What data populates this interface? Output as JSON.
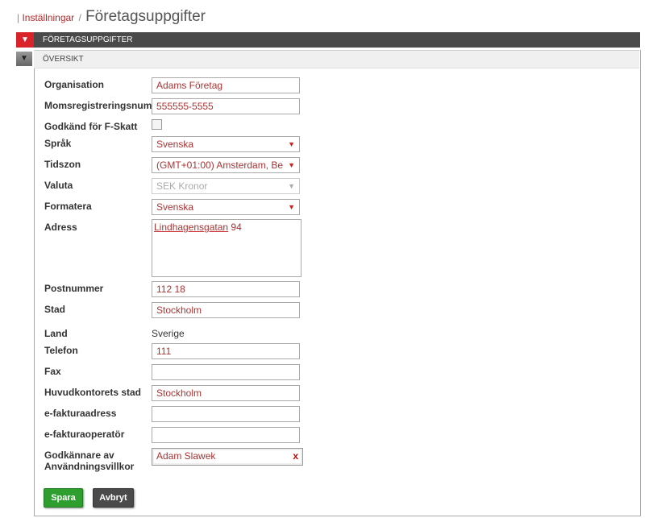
{
  "breadcrumb": {
    "parent": "Inställningar",
    "separator": "/",
    "title": "Företagsuppgifter"
  },
  "section": {
    "title": "FÖRETAGSUPPGIFTER",
    "subtitle": "ÖVERSIKT"
  },
  "icons": {
    "collapse": "▼",
    "select_arrow": "▼",
    "clear": "x"
  },
  "form": {
    "organisation": {
      "label": "Organisation",
      "value": "Adams Företag"
    },
    "moms": {
      "label": "Momsregistreringsnum",
      "value": "555555-5555"
    },
    "fskatt": {
      "label": "Godkänd för F-Skatt",
      "checked": false
    },
    "sprak": {
      "label": "Språk",
      "value": "Svenska"
    },
    "tidszon": {
      "label": "Tidszon",
      "value": "(GMT+01:00) Amsterdam, Be"
    },
    "valuta": {
      "label": "Valuta",
      "value": "SEK Kronor"
    },
    "formatera": {
      "label": "Formatera",
      "value": "Svenska"
    },
    "adress": {
      "label": "Adress",
      "value_street": "Lindhagensgatan",
      "value_number": " 94"
    },
    "postnummer": {
      "label": "Postnummer",
      "value": "112 18"
    },
    "stad": {
      "label": "Stad",
      "value": "Stockholm"
    },
    "land": {
      "label": "Land",
      "value": "Sverige"
    },
    "telefon": {
      "label": "Telefon",
      "value": "111"
    },
    "fax": {
      "label": "Fax",
      "value": ""
    },
    "huvudkontor": {
      "label": "Huvudkontorets stad",
      "value": "Stockholm"
    },
    "efakturaadress": {
      "label": "e-fakturaadress",
      "value": ""
    },
    "efakturaoperator": {
      "label": "e-fakturaoperatör",
      "value": ""
    },
    "godkannare": {
      "label_1": "Godkännare av",
      "label_2": "Användningsvillkor",
      "value": "Adam Slawek"
    }
  },
  "buttons": {
    "save": "Spara",
    "cancel": "Avbryt"
  }
}
